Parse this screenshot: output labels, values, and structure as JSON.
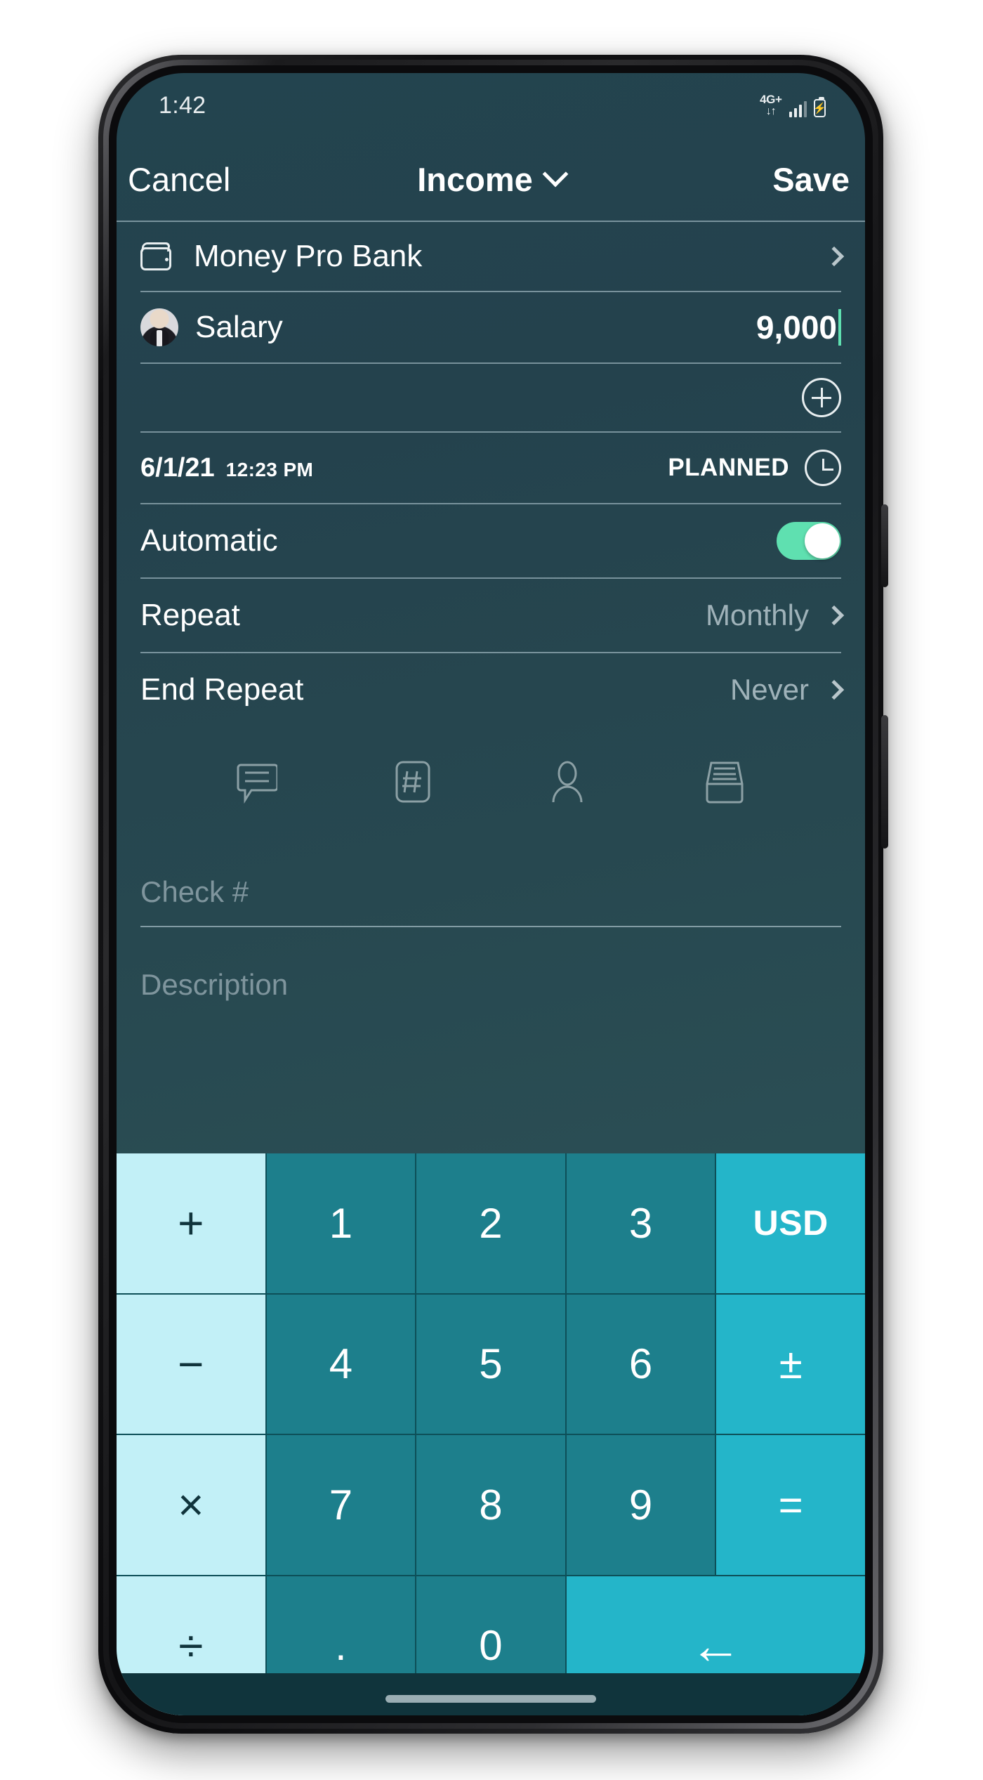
{
  "status_bar": {
    "time": "1:42",
    "network_label": "4G+",
    "network_arrows": "↓↑",
    "battery_icon": "battery-charging-icon",
    "signal_icon": "signal-bars-icon"
  },
  "navbar": {
    "cancel_label": "Cancel",
    "title": "Income",
    "title_chevron_icon": "chevron-down-icon",
    "save_label": "Save"
  },
  "form": {
    "account": {
      "icon": "wallet-icon",
      "name": "Money Pro Bank",
      "chevron_icon": "chevron-right-icon"
    },
    "category": {
      "avatar_icon": "person-photo-avatar",
      "name": "Salary",
      "amount": "9,000"
    },
    "add_row": {
      "icon": "plus-circle-icon"
    },
    "date_row": {
      "date": "6/1/21",
      "time": "12:23 PM",
      "status": "PLANNED",
      "clock_icon": "clock-icon"
    },
    "automatic": {
      "label": "Automatic",
      "state": "on"
    },
    "repeat": {
      "label": "Repeat",
      "value": "Monthly",
      "chevron_icon": "chevron-right-icon"
    },
    "end_repeat": {
      "label": "End Repeat",
      "value": "Never",
      "chevron_icon": "chevron-right-icon"
    },
    "icon_strip": [
      {
        "name": "note-comment-icon"
      },
      {
        "name": "check-number-icon"
      },
      {
        "name": "payee-person-icon"
      },
      {
        "name": "file-box-icon"
      }
    ],
    "check_field": {
      "placeholder": "Check #",
      "value": ""
    },
    "description_field": {
      "placeholder": "Description",
      "value": ""
    }
  },
  "keypad": {
    "keys": [
      {
        "label": "+",
        "type": "op",
        "name": "key-plus"
      },
      {
        "label": "1",
        "type": "num",
        "name": "key-1"
      },
      {
        "label": "2",
        "type": "num",
        "name": "key-2"
      },
      {
        "label": "3",
        "type": "num",
        "name": "key-3"
      },
      {
        "label": "USD",
        "type": "acc",
        "name": "key-currency-usd"
      },
      {
        "label": "−",
        "type": "op",
        "name": "key-minus"
      },
      {
        "label": "4",
        "type": "num",
        "name": "key-4"
      },
      {
        "label": "5",
        "type": "num",
        "name": "key-5"
      },
      {
        "label": "6",
        "type": "num",
        "name": "key-6"
      },
      {
        "label": "±",
        "type": "acc",
        "name": "key-plus-minus"
      },
      {
        "label": "×",
        "type": "op",
        "name": "key-multiply"
      },
      {
        "label": "7",
        "type": "num",
        "name": "key-7"
      },
      {
        "label": "8",
        "type": "num",
        "name": "key-8"
      },
      {
        "label": "9",
        "type": "num",
        "name": "key-9"
      },
      {
        "label": "=",
        "type": "acc",
        "name": "key-equals"
      },
      {
        "label": "÷",
        "type": "op",
        "name": "key-divide"
      },
      {
        "label": ".",
        "type": "num",
        "name": "key-decimal"
      },
      {
        "label": "0",
        "type": "num",
        "name": "key-0"
      },
      {
        "label": "←",
        "type": "acc",
        "name": "key-backspace"
      }
    ],
    "currency": "USD"
  },
  "colors": {
    "screen_bg_top": "#23444f",
    "screen_bg_bottom": "#2c5a5c",
    "accent_green": "#5fe0b0",
    "key_operator": "#c2f0f7",
    "key_number": "#1d7f8c",
    "key_accent": "#24b5c9",
    "text_primary": "#ffffff",
    "text_muted": "#9fb2b9"
  }
}
